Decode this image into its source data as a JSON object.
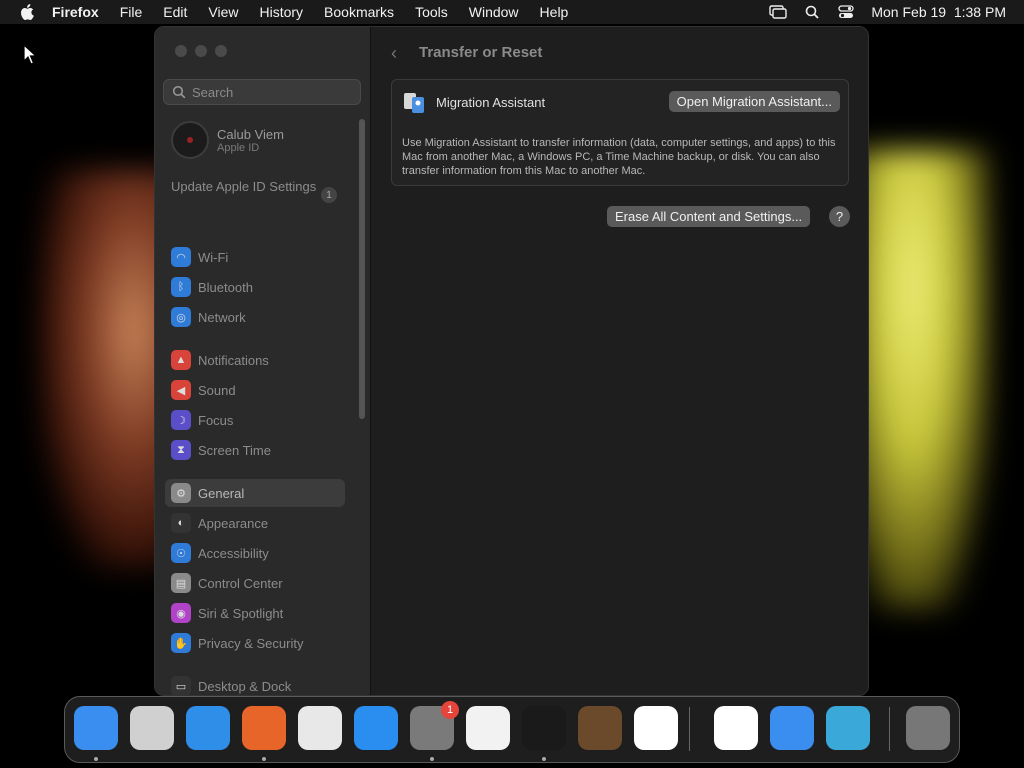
{
  "menubar": {
    "app": "Firefox",
    "items": [
      "File",
      "Edit",
      "View",
      "History",
      "Bookmarks",
      "Tools",
      "Window",
      "Help"
    ],
    "datetime": "Mon Feb 19  1:38 PM"
  },
  "sidebar": {
    "search_placeholder": "Search",
    "profile": {
      "name": "Calub Viem",
      "subtitle": "Apple ID"
    },
    "update": {
      "label": "Update Apple ID Settings",
      "count": "1"
    },
    "items": [
      {
        "label": "Wi-Fi",
        "icon": "wifi-icon",
        "color": "#2f7bd8"
      },
      {
        "label": "Bluetooth",
        "icon": "bluetooth-icon",
        "color": "#2f7bd8"
      },
      {
        "label": "Network",
        "icon": "globe-icon",
        "color": "#2f7bd8"
      },
      {
        "label": "Notifications",
        "icon": "bell-icon",
        "color": "#d9443a"
      },
      {
        "label": "Sound",
        "icon": "speaker-icon",
        "color": "#d9443a"
      },
      {
        "label": "Focus",
        "icon": "moon-icon",
        "color": "#5b4fc9"
      },
      {
        "label": "Screen Time",
        "icon": "hourglass-icon",
        "color": "#5b4fc9"
      },
      {
        "label": "General",
        "icon": "gear-icon",
        "color": "#8a8a8a"
      },
      {
        "label": "Appearance",
        "icon": "appearance-icon",
        "color": "#333333"
      },
      {
        "label": "Accessibility",
        "icon": "accessibility-icon",
        "color": "#2f7bd8"
      },
      {
        "label": "Control Center",
        "icon": "control-center-icon",
        "color": "#8a8a8a"
      },
      {
        "label": "Siri & Spotlight",
        "icon": "siri-icon",
        "color": "#b043c8"
      },
      {
        "label": "Privacy & Security",
        "icon": "hand-icon",
        "color": "#2f7bd8"
      },
      {
        "label": "Desktop & Dock",
        "icon": "dock-icon",
        "color": "#333333"
      }
    ]
  },
  "content": {
    "title": "Transfer or Reset",
    "migration": {
      "title": "Migration Assistant",
      "button": "Open Migration Assistant...",
      "description": "Use Migration Assistant to transfer information (data, computer settings, and apps) to this Mac from another Mac, a Windows PC, a Time Machine backup, or disk. You can also transfer information from this Mac to another Mac."
    },
    "erase_button": "Erase All Content and Settings...",
    "help_button": "?"
  },
  "dock": {
    "apps": [
      {
        "name": "finder",
        "color": "#3a8ef0",
        "running": true
      },
      {
        "name": "launchpad",
        "color": "#d0d0d0",
        "running": false
      },
      {
        "name": "safari",
        "color": "#2f8fe8",
        "running": false
      },
      {
        "name": "firefox",
        "color": "#e8652a",
        "running": true
      },
      {
        "name": "chrome",
        "color": "#e8e8e8",
        "running": false
      },
      {
        "name": "app-store",
        "color": "#2a8df0",
        "running": false
      },
      {
        "name": "system-settings",
        "color": "#7a7a7a",
        "running": true,
        "badge": "1"
      },
      {
        "name": "textedit",
        "color": "#f2f2f2",
        "running": false
      },
      {
        "name": "terminal",
        "color": "#1a1a1a",
        "running": true
      },
      {
        "name": "garageband",
        "color": "#6a4a2a",
        "running": false
      },
      {
        "name": "vscode",
        "color": "#ffffff",
        "running": false
      },
      {
        "name": "visual-studio",
        "color": "#ffffff",
        "running": false
      },
      {
        "name": "weather",
        "color": "#3a8ef0",
        "running": false
      },
      {
        "name": "screen-sharing",
        "color": "#3aa8d8",
        "running": false
      },
      {
        "name": "trash",
        "color": "#777777",
        "running": false
      }
    ]
  }
}
